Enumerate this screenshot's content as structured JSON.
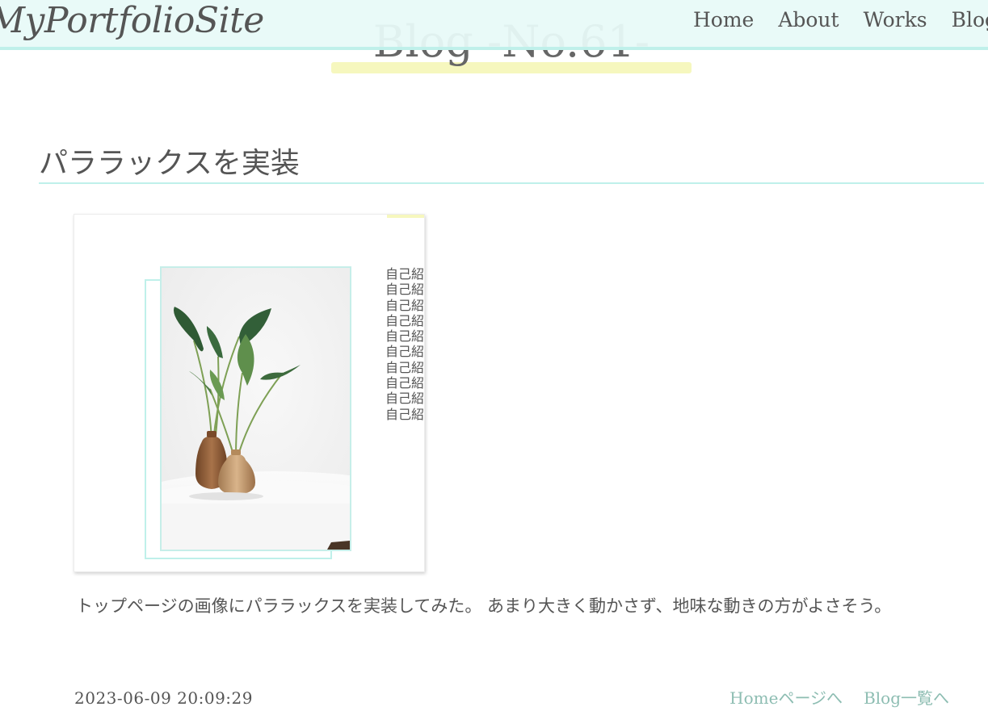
{
  "header": {
    "logo": "MyPortfolioSite",
    "nav": [
      "Home",
      "About",
      "Works",
      "Blog"
    ]
  },
  "page_title": "Blog -No.61-",
  "post": {
    "heading": "パララックスを実装",
    "side_text_lines": [
      "自己紹",
      "自己紹",
      "自己紹",
      "自己紹",
      "自己紹",
      "自己紹",
      "自己紹",
      "自己紹",
      "自己紹",
      "自己紹"
    ],
    "body": "トップページの画像にパララックスを実装してみた。 あまり大きく動かさず、地味な動きの方がよさそう。",
    "date": "2023-06-09 20:09:29",
    "links": {
      "home": "Homeページへ",
      "blog_list": "Blog一覧へ"
    }
  },
  "colors": {
    "header_bg": "#e8faf8",
    "accent_mint": "#bff0ea",
    "accent_yellow": "#f6f7be",
    "link": "#8dbdb2",
    "text": "#555555"
  }
}
